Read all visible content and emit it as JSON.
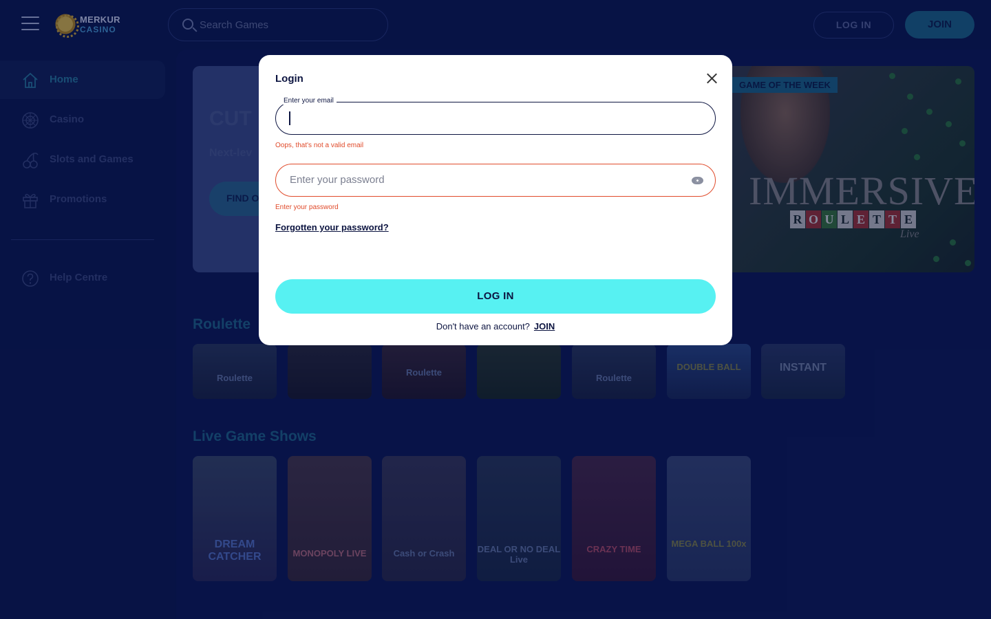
{
  "header": {
    "logo_line1": "MERKUR",
    "logo_line2": "CASINO",
    "search_placeholder": "Search Games",
    "login_label": "LOG IN",
    "join_label": "JOIN"
  },
  "sidebar": {
    "items": [
      {
        "label": "Home",
        "icon": "home-icon",
        "active": true
      },
      {
        "label": "Casino",
        "icon": "roulette-wheel-icon",
        "active": false
      },
      {
        "label": "Slots and Games",
        "icon": "cherries-icon",
        "active": false
      },
      {
        "label": "Promotions",
        "icon": "gift-icon",
        "active": false
      }
    ],
    "help_label": "Help Centre",
    "help_icon": "help-circle-icon"
  },
  "hero": {
    "title_partial": "CUT",
    "subtitle_partial": "Next-lev",
    "button_partial": "FIND O",
    "badge": "GAME OF THE WEEK",
    "game_title": "IMMERSIVE",
    "game_letters": [
      "R",
      "O",
      "U",
      "L",
      "E",
      "T",
      "T",
      "E"
    ],
    "game_live": "Live"
  },
  "sections": [
    {
      "title": "Roulette",
      "tiles": [
        "Roulette",
        "",
        "Roulette",
        "",
        "Roulette",
        "DOUBLE BALL",
        "INSTANT"
      ]
    },
    {
      "title": "Live Game Shows",
      "tiles": [
        "DREAM CATCHER",
        "MONOPOLY LIVE",
        "Cash or Crash",
        "DEAL OR NO DEAL Live",
        "CRAZY TIME",
        "MEGA BALL 100x"
      ]
    }
  ],
  "modal": {
    "title": "Login",
    "email_label": "Enter your email",
    "email_value": "",
    "email_error": "Oops, that's not a valid email",
    "password_placeholder": "Enter your password",
    "password_error": "Enter your password",
    "forgot_label": "Forgotten your password?",
    "login_label": "LOG IN",
    "signup_prompt": "Don't have an account?",
    "join_label": "JOIN"
  },
  "colors": {
    "background": "#0a1850",
    "accent_cyan": "#57f1f2",
    "error": "#e04a2a",
    "brand_teal": "#1d6a8d"
  }
}
